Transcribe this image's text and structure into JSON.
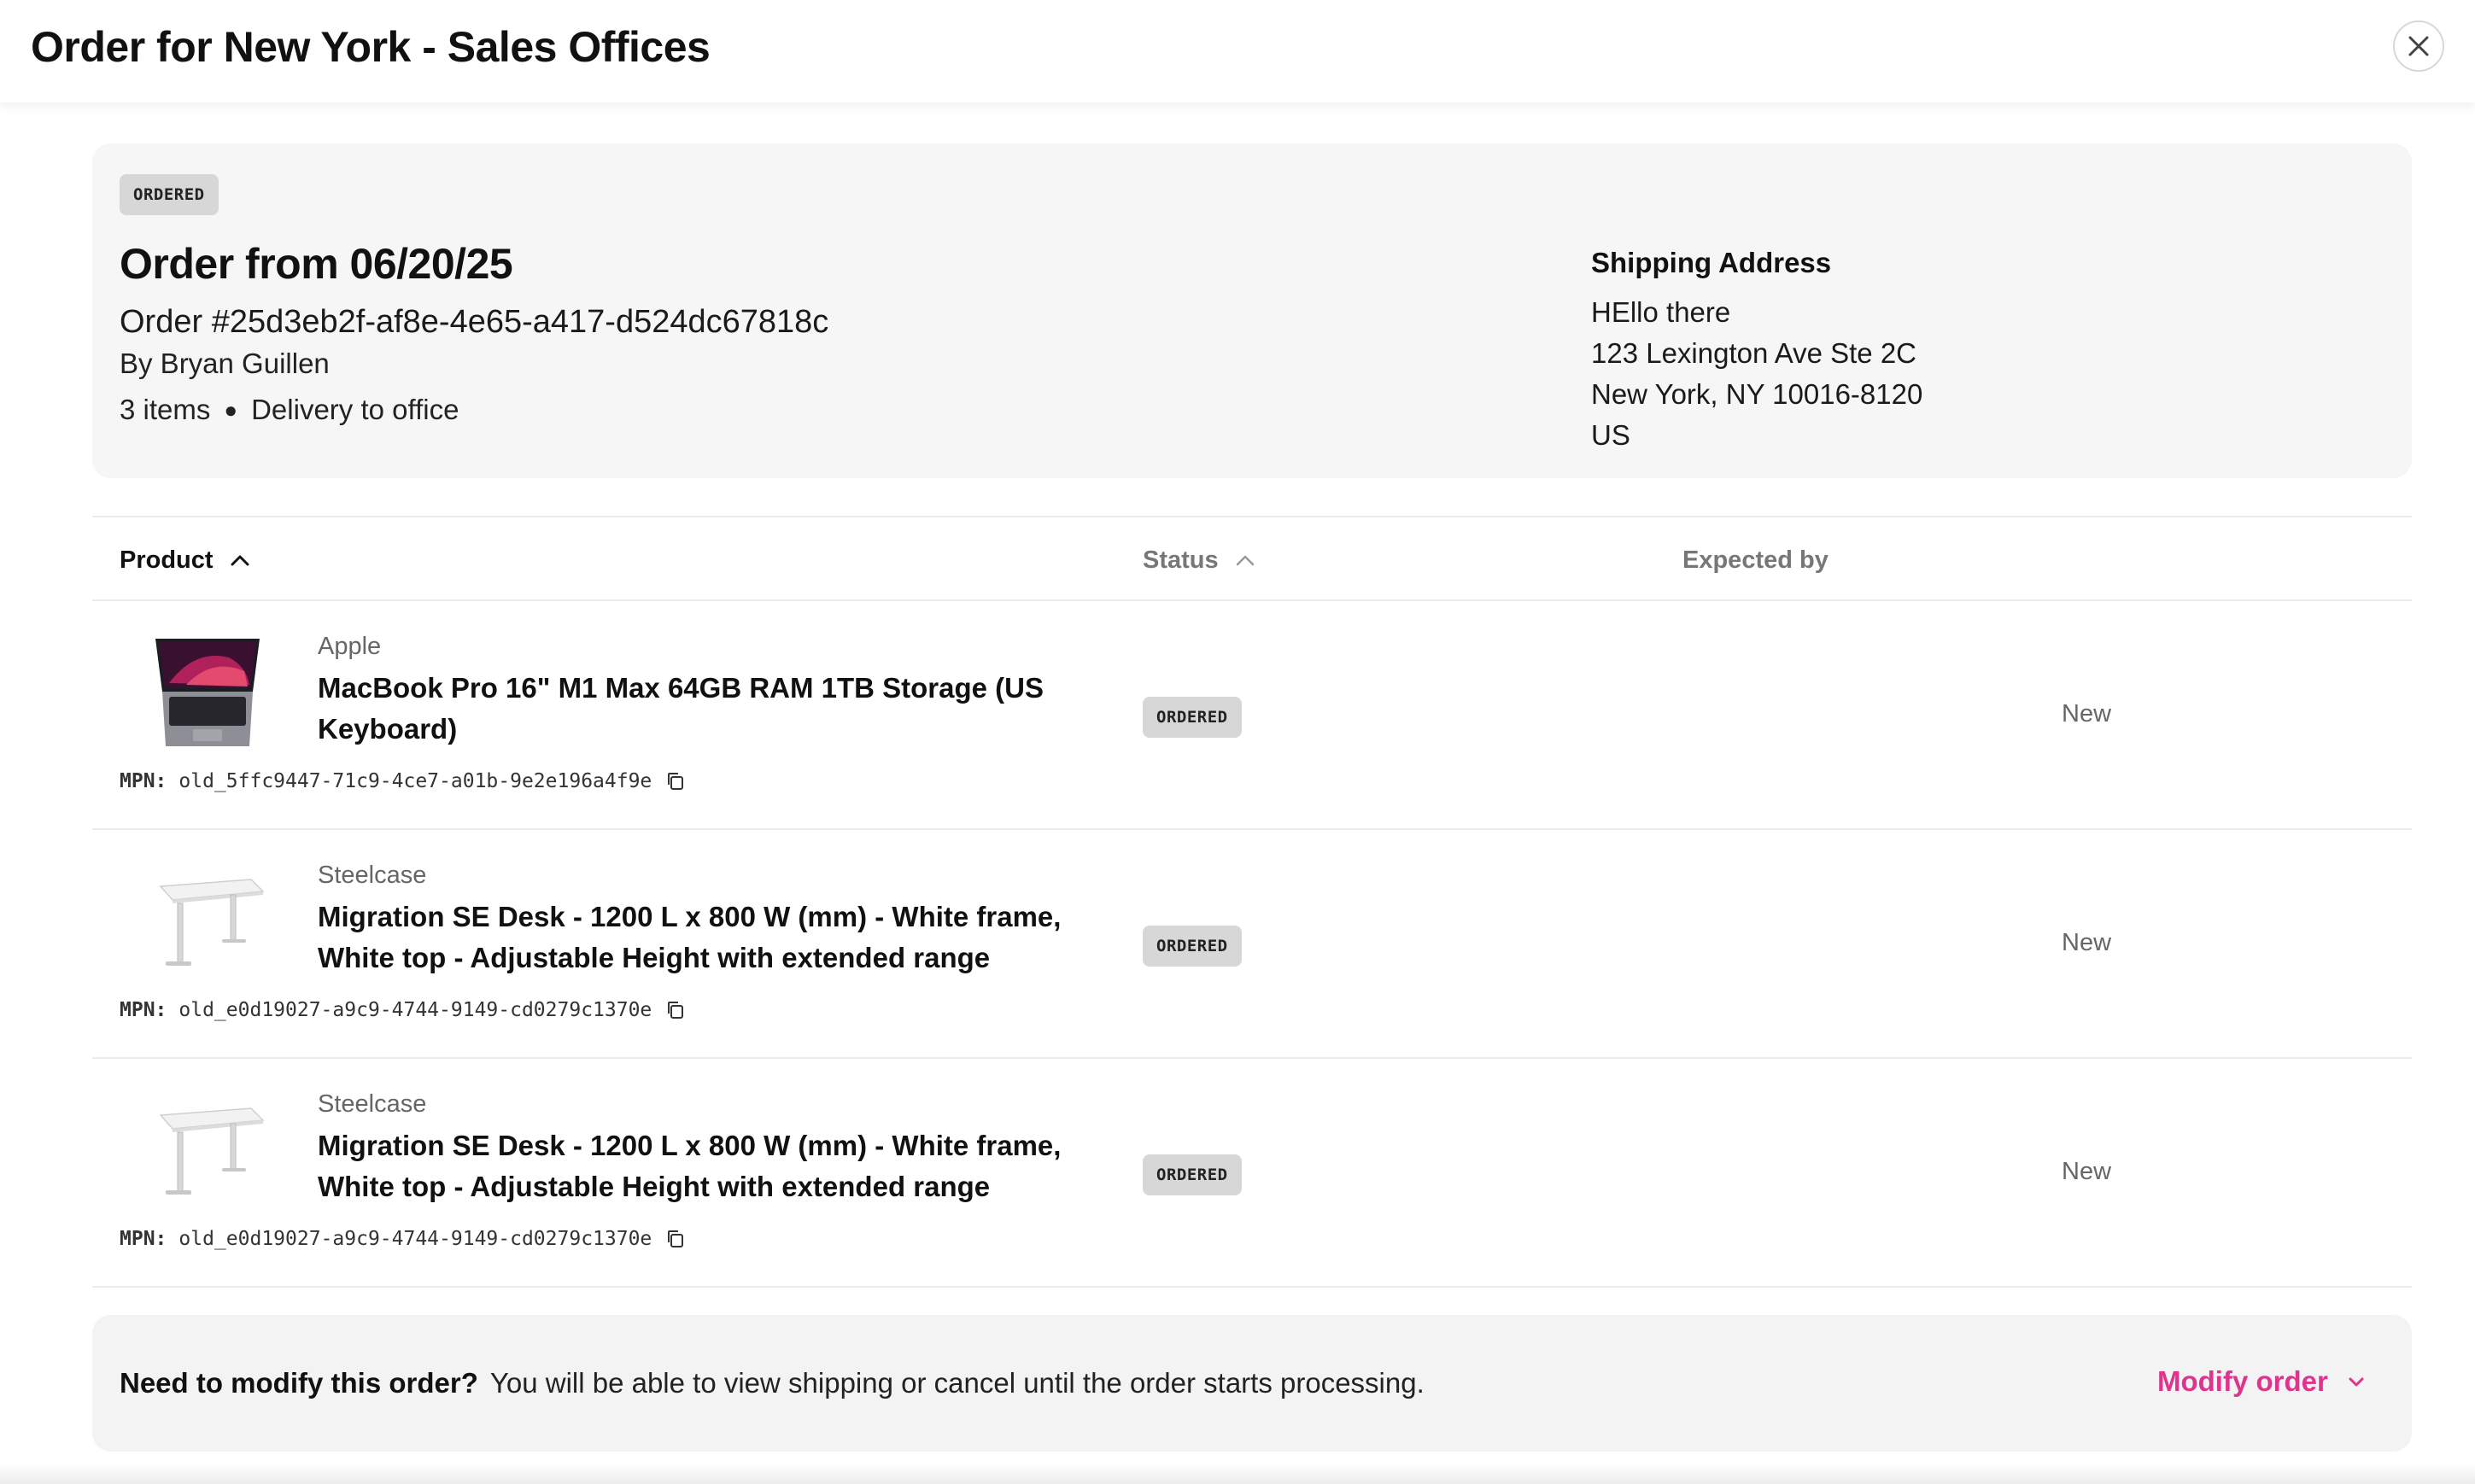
{
  "header": {
    "title": "Order for New York - Sales Offices",
    "close_icon": "close-icon"
  },
  "summary": {
    "status_badge": "ORDERED",
    "title": "Order from 06/20/25",
    "order_number": "Order #25d3eb2f-af8e-4e65-a417-d524dc67818c",
    "ordered_by": "By Bryan Guillen",
    "item_count": "3 items",
    "delivery": "Delivery to office",
    "shipping": {
      "heading": "Shipping Address",
      "lines": [
        "HEllo there",
        "123 Lexington Ave Ste 2C",
        "New York, NY 10016-8120",
        "US"
      ]
    }
  },
  "table": {
    "columns": [
      "Product",
      "Status",
      "Expected by"
    ],
    "mpn_label": "MPN:",
    "rows": [
      {
        "brand": "Apple",
        "name": "MacBook Pro 16\" M1 Max 64GB RAM 1TB Storage (US Keyboard)",
        "mpn": "old_5ffc9447-71c9-4ce7-a01b-9e2e196a4f9e",
        "status": "ORDERED",
        "condition": "New",
        "image": "laptop-image"
      },
      {
        "brand": "Steelcase",
        "name": "Migration SE Desk - 1200 L x 800 W (mm) - White frame, White top - Adjustable Height with extended range",
        "mpn": "old_e0d19027-a9c9-4744-9149-cd0279c1370e",
        "status": "ORDERED",
        "condition": "New",
        "image": "desk-image"
      },
      {
        "brand": "Steelcase",
        "name": "Migration SE Desk - 1200 L x 800 W (mm) - White frame, White top - Adjustable Height with extended range",
        "mpn": "old_e0d19027-a9c9-4744-9149-cd0279c1370e",
        "status": "ORDERED",
        "condition": "New",
        "image": "desk-image"
      }
    ]
  },
  "banner": {
    "heading": "Need to modify this order?",
    "text": "You will be able to view shipping or cancel until the order starts processing.",
    "action": "Modify order"
  },
  "colors": {
    "accent": "#e0338d",
    "card_bg": "#f6f6f6",
    "badge_bg": "#d7d7d7"
  }
}
